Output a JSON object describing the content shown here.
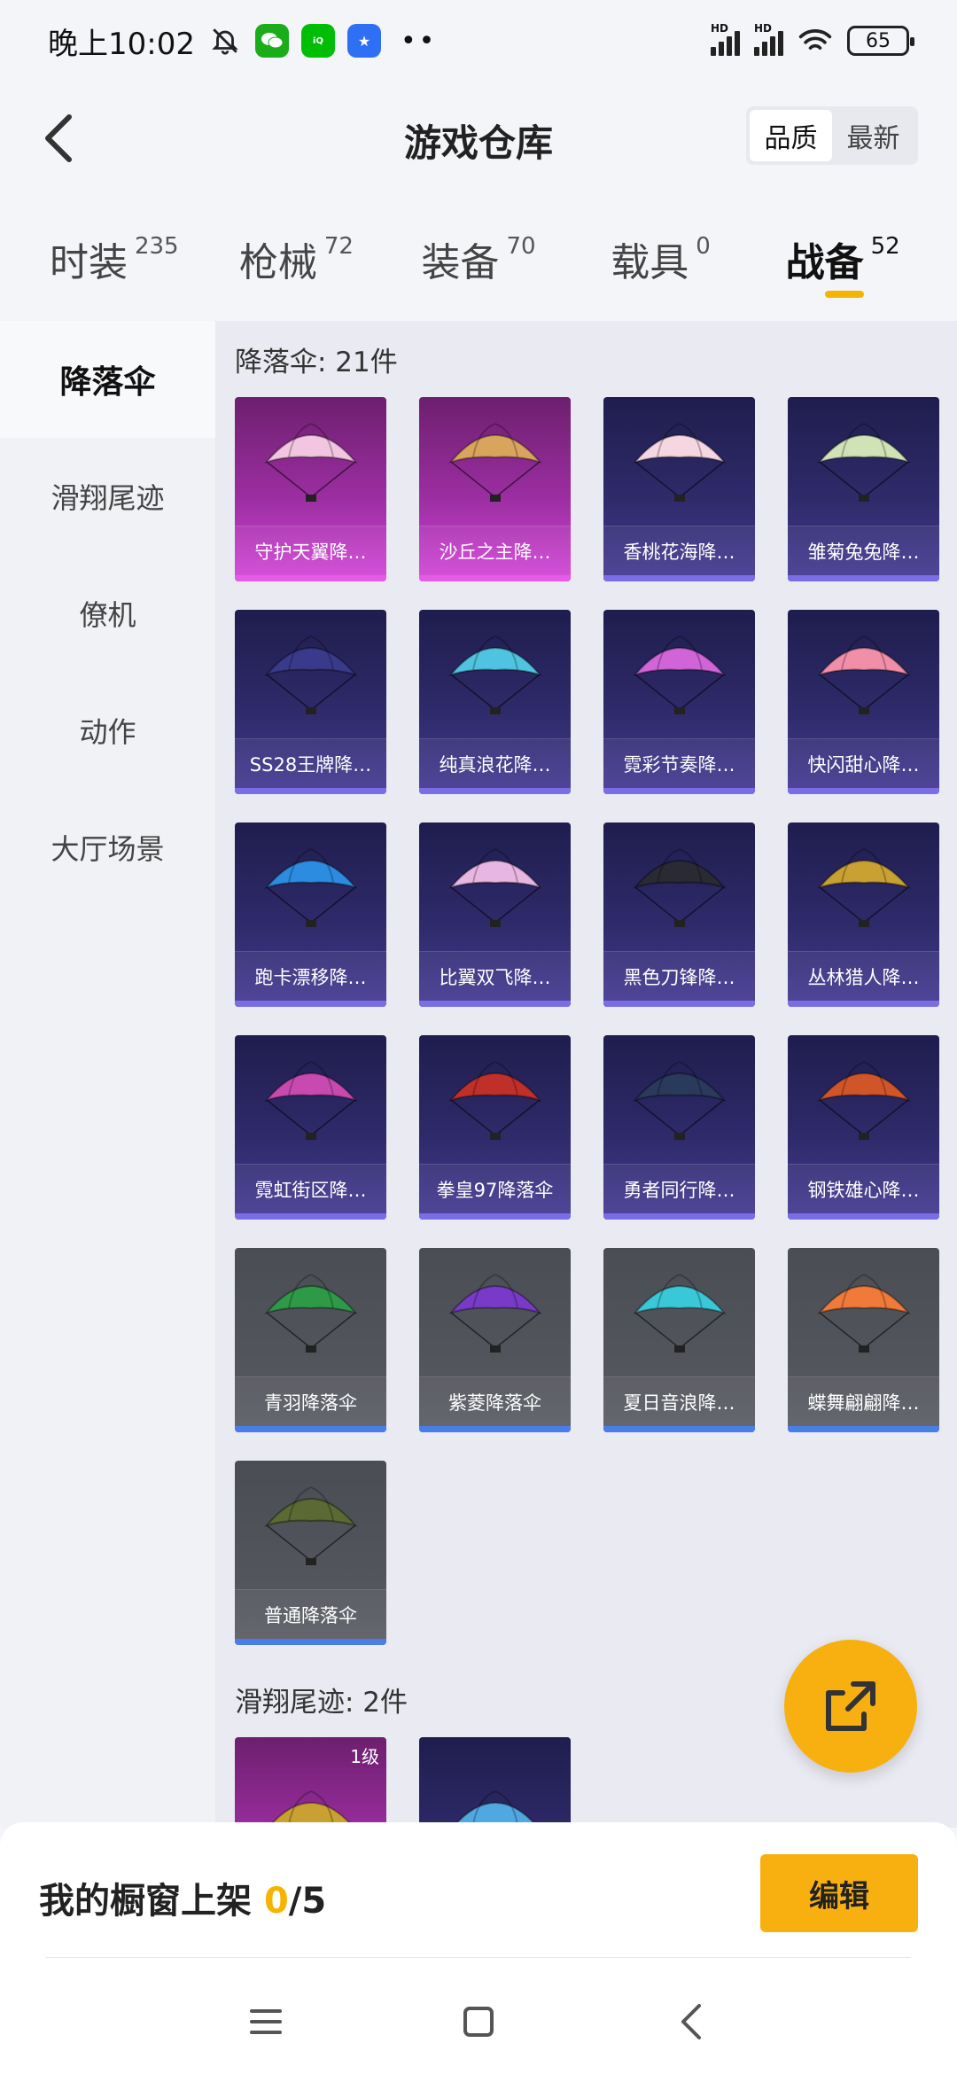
{
  "status": {
    "time": "晚上10:02",
    "battery": "65",
    "app_badges": [
      "wechat",
      "iqiyi",
      "blue-app"
    ],
    "dots": "••"
  },
  "header": {
    "title": "游戏仓库",
    "sort_options": [
      "品质",
      "最新"
    ],
    "sort_active": "品质"
  },
  "tabs": [
    {
      "label": "时装",
      "count": "235"
    },
    {
      "label": "枪械",
      "count": "72"
    },
    {
      "label": "装备",
      "count": "70"
    },
    {
      "label": "载具",
      "count": "0"
    },
    {
      "label": "战备",
      "count": "52"
    }
  ],
  "sidebar": [
    "降落伞",
    "滑翔尾迹",
    "僚机",
    "动作",
    "大厅场景"
  ],
  "sections": [
    {
      "title": "降落伞: 21件",
      "items": [
        {
          "name": "守护天翼降…",
          "rarity": "pink",
          "color": "#f2c6e0"
        },
        {
          "name": "沙丘之主降…",
          "rarity": "pink",
          "color": "#d9a55c"
        },
        {
          "name": "香桃花海降…",
          "rarity": "purple",
          "color": "#f6d6e0"
        },
        {
          "name": "雏菊兔兔降…",
          "rarity": "purple",
          "color": "#cfe3b6"
        },
        {
          "name": "SS28王牌降…",
          "rarity": "purple",
          "color": "#3a3a8c"
        },
        {
          "name": "纯真浪花降…",
          "rarity": "purple",
          "color": "#4fc3e0"
        },
        {
          "name": "霓彩节奏降…",
          "rarity": "purple",
          "color": "#d064d8"
        },
        {
          "name": "快闪甜心降…",
          "rarity": "purple",
          "color": "#f28fa8"
        },
        {
          "name": "跑卡漂移降…",
          "rarity": "purple",
          "color": "#2c8ce0"
        },
        {
          "name": "比翼双飞降…",
          "rarity": "purple",
          "color": "#e8b6e2"
        },
        {
          "name": "黑色刀锋降…",
          "rarity": "purple",
          "color": "#2a2a34"
        },
        {
          "name": "丛林猎人降…",
          "rarity": "purple",
          "color": "#c9a032"
        },
        {
          "name": "霓虹街区降…",
          "rarity": "purple",
          "color": "#c84ab0"
        },
        {
          "name": "拳皇97降落伞",
          "rarity": "purple",
          "color": "#c0302a"
        },
        {
          "name": "勇者同行降…",
          "rarity": "purple",
          "color": "#2a3a5c"
        },
        {
          "name": "钢铁雄心降…",
          "rarity": "purple",
          "color": "#d0562a"
        },
        {
          "name": "青羽降落伞",
          "rarity": "gray",
          "color": "#2e9a48"
        },
        {
          "name": "紫菱降落伞",
          "rarity": "gray",
          "color": "#7a3ac8"
        },
        {
          "name": "夏日音浪降…",
          "rarity": "gray",
          "color": "#3ac8d8"
        },
        {
          "name": "蝶舞翩翩降…",
          "rarity": "gray",
          "color": "#f07a3a"
        },
        {
          "name": "普通降落伞",
          "rarity": "gray",
          "color": "#5a6a32"
        }
      ]
    },
    {
      "title": "滑翔尾迹: 2件",
      "items": [
        {
          "name": "",
          "rarity": "pink",
          "color": "#c9a032",
          "level": "1级"
        },
        {
          "name": "",
          "rarity": "purple",
          "color": "#4fa8e0"
        }
      ]
    }
  ],
  "bottom": {
    "showcase_label": "我的橱窗上架 ",
    "showcase_count": "0",
    "showcase_total": "/5",
    "edit_label": "编辑"
  }
}
